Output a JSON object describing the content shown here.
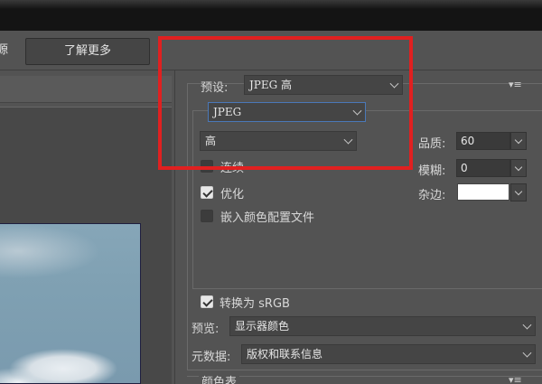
{
  "toolbar": {
    "partial_label": "源",
    "learn_more": "了解更多"
  },
  "preset": {
    "label": "预设:",
    "value": "JPEG 高",
    "menu_icon": "panel-menu-icon"
  },
  "format": {
    "value": "JPEG"
  },
  "quality_preset": {
    "value": "高"
  },
  "quality": {
    "label": "品质:",
    "value": "60"
  },
  "blur": {
    "label": "模糊:",
    "value": "0"
  },
  "matte": {
    "label": "杂边:",
    "color": "#ffffff"
  },
  "options": {
    "progressive": {
      "label": "连续",
      "checked": false
    },
    "optimized": {
      "label": "优化",
      "checked": true
    },
    "embed_profile": {
      "label": "嵌入颜色配置文件",
      "checked": false
    }
  },
  "convert": {
    "label": "转换为 sRGB",
    "checked": true
  },
  "preview": {
    "label": "预览:",
    "value": "显示器颜色"
  },
  "metadata": {
    "label": "元数据:",
    "value": "版权和联系信息"
  },
  "color_table": {
    "label": "颜色表"
  },
  "colors": {
    "annotation": "#e02020"
  }
}
